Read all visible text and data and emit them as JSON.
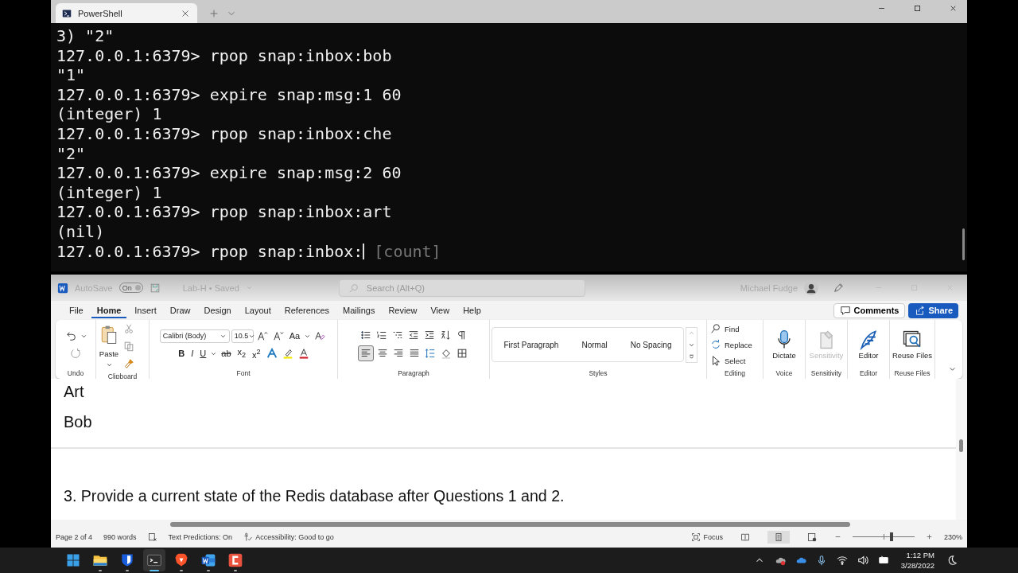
{
  "terminal": {
    "tab": {
      "title": "PowerShell"
    },
    "lines": [
      "3) \"2\"",
      "127.0.0.1:6379> rpop snap:inbox:bob",
      "\"1\"",
      "127.0.0.1:6379> expire snap:msg:1 60",
      "(integer) 1",
      "127.0.0.1:6379> rpop snap:inbox:che",
      "\"2\"",
      "127.0.0.1:6379> expire snap:msg:2 60",
      "(integer) 1",
      "127.0.0.1:6379> rpop snap:inbox:art",
      "(nil)"
    ],
    "prompt": {
      "text": "127.0.0.1:6379> rpop snap:inbox:",
      "hint": "[count]"
    }
  },
  "word": {
    "title_bar": {
      "autosave": {
        "label": "AutoSave",
        "state": "On",
        "on": true
      },
      "document": "Lab-H • Saved",
      "search": {
        "placeholder": "Search (Alt+Q)"
      },
      "user": "Michael Fudge"
    },
    "tabs": [
      {
        "label": "File",
        "selected": false
      },
      {
        "label": "Home",
        "selected": true
      },
      {
        "label": "Insert",
        "selected": false
      },
      {
        "label": "Draw",
        "selected": false
      },
      {
        "label": "Design",
        "selected": false
      },
      {
        "label": "Layout",
        "selected": false
      },
      {
        "label": "References",
        "selected": false
      },
      {
        "label": "Mailings",
        "selected": false
      },
      {
        "label": "Review",
        "selected": false
      },
      {
        "label": "View",
        "selected": false
      },
      {
        "label": "Help",
        "selected": false
      }
    ],
    "actions": {
      "comments": "Comments",
      "share": "Share"
    },
    "ribbon": {
      "undo": {
        "label": "Undo"
      },
      "clipboard": {
        "paste": "Paste",
        "label": "Clipboard"
      },
      "font": {
        "name": "Calibri (Body)",
        "size": "10.5",
        "change_case": "Aa",
        "bold": "B",
        "italic": "I",
        "underline": "U",
        "strike": "ab",
        "subscript": "x$_{2}$",
        "superscript": "x$^{2}$",
        "label": "Font"
      },
      "paragraph": {
        "label": "Paragraph",
        "align_buttons": [
          {
            "kind": "left",
            "selected": true
          },
          {
            "kind": "center",
            "selected": false
          },
          {
            "kind": "right",
            "selected": false
          },
          {
            "kind": "justify",
            "selected": false
          }
        ]
      },
      "styles": {
        "items": [
          "First Paragraph",
          "Normal",
          "No Spacing"
        ],
        "label": "Styles"
      },
      "editing": {
        "items": [
          {
            "kind": "find",
            "label": "Find"
          },
          {
            "kind": "replace",
            "label": "Replace"
          },
          {
            "kind": "select",
            "label": "Select"
          }
        ],
        "label": "Editing"
      },
      "big_buttons": [
        {
          "kind": "dictate",
          "label": "Dictate",
          "group": "Voice",
          "disabled": false
        },
        {
          "kind": "sensitivity",
          "label": "Sensitivity",
          "group": "Sensitivity",
          "disabled": true
        },
        {
          "kind": "editor",
          "label": "Editor",
          "group": "Editor",
          "disabled": false
        },
        {
          "kind": "reuse",
          "label": "Reuse Files",
          "group": "Reuse Files",
          "disabled": false
        }
      ]
    },
    "document": {
      "paragraphs": [
        "Art",
        "Bob"
      ],
      "question": "3. Provide a current state of the Redis database after Questions 1 and 2."
    },
    "status_bar": {
      "page": "Page 2 of 4",
      "words": "990 words",
      "predictions": "Text Predictions: On",
      "accessibility": "Accessibility: Good to go",
      "focus": "Focus",
      "views": [
        {
          "kind": "read",
          "selected": false
        },
        {
          "kind": "print",
          "selected": true
        },
        {
          "kind": "web",
          "selected": false
        }
      ],
      "zoom": {
        "level": 0.63,
        "reading": "230%"
      }
    }
  },
  "taskbar": {
    "apps": [
      {
        "kind": "start",
        "running": false,
        "selected": false
      },
      {
        "kind": "folder",
        "running": true,
        "selected": false
      },
      {
        "kind": "shield",
        "running": true,
        "selected": false
      },
      {
        "kind": "terminal",
        "running": true,
        "selected": true
      },
      {
        "kind": "lion",
        "running": true,
        "selected": false
      },
      {
        "kind": "word",
        "running": true,
        "selected": false
      },
      {
        "kind": "app",
        "running": true,
        "selected": false
      }
    ],
    "clock": {
      "time": "1:12 PM",
      "date": "3/28/2022"
    }
  }
}
